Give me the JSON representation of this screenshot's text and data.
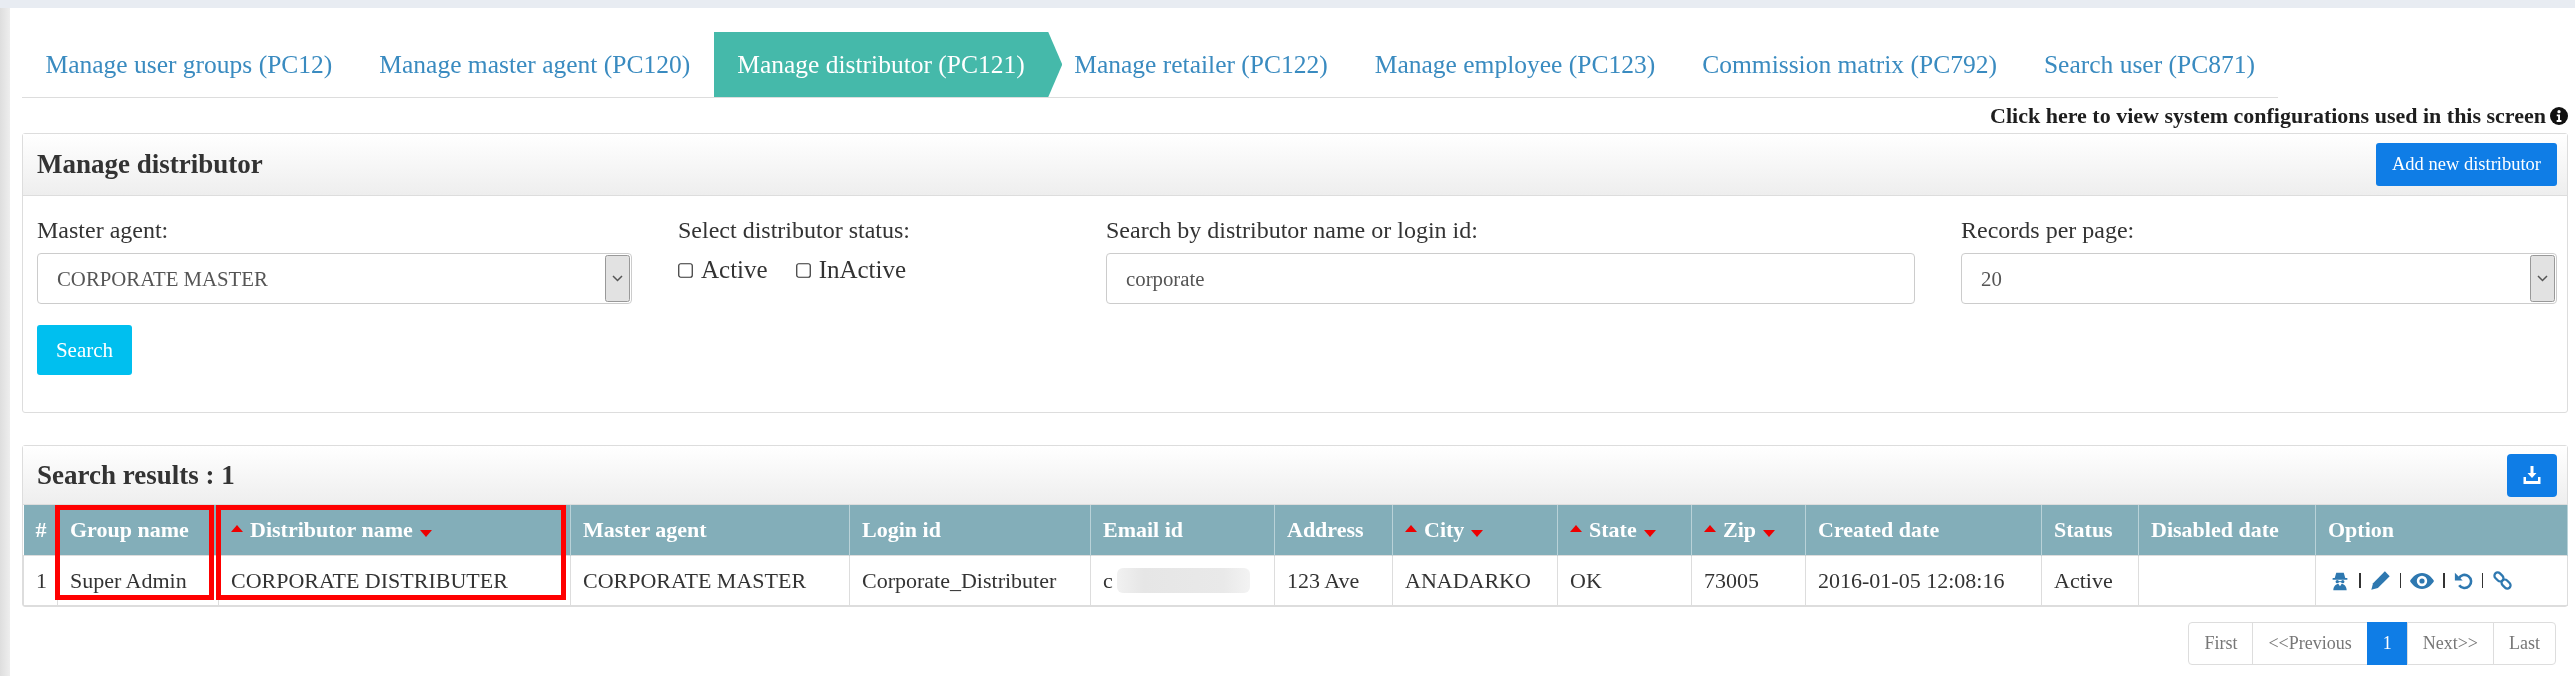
{
  "tabs": [
    {
      "label": "Manage user groups (PC12)",
      "selected": false
    },
    {
      "label": "Manage master agent (PC120)",
      "selected": false
    },
    {
      "label": "Manage distributor (PC121)",
      "selected": true
    },
    {
      "label": "Manage retailer (PC122)",
      "selected": false
    },
    {
      "label": "Manage employee (PC123)",
      "selected": false
    },
    {
      "label": "Commission matrix (PC792)",
      "selected": false
    },
    {
      "label": "Search user (PC871)",
      "selected": false
    }
  ],
  "config_link": "Click here to view system configurations used in this screen",
  "filter_panel": {
    "title": "Manage distributor",
    "add_button": "Add new distributor",
    "master_agent": {
      "label": "Master agent:",
      "value": "CORPORATE MASTER"
    },
    "status": {
      "label": "Select distributor status:",
      "options": [
        {
          "label": "Active",
          "checked": false
        },
        {
          "label": "InActive",
          "checked": false
        }
      ]
    },
    "search": {
      "label": "Search by distributor name or login id:",
      "value": "corporate"
    },
    "records_per_page": {
      "label": "Records per page:",
      "value": "20"
    },
    "search_button": "Search"
  },
  "results_panel": {
    "title": "Search results : 1",
    "table": {
      "columns": [
        {
          "label": "#",
          "sortable": false,
          "highlighted": false
        },
        {
          "label": "Group name",
          "sortable": false,
          "highlighted": true
        },
        {
          "label": "Distributor name",
          "sortable": true,
          "highlighted": true
        },
        {
          "label": "Master agent",
          "sortable": false,
          "highlighted": false
        },
        {
          "label": "Login id",
          "sortable": false,
          "highlighted": false
        },
        {
          "label": "Email id",
          "sortable": false,
          "highlighted": false
        },
        {
          "label": "Address",
          "sortable": false,
          "highlighted": false
        },
        {
          "label": "City",
          "sortable": true,
          "highlighted": false
        },
        {
          "label": "State",
          "sortable": true,
          "highlighted": false
        },
        {
          "label": "Zip",
          "sortable": true,
          "highlighted": false
        },
        {
          "label": "Created date",
          "sortable": false,
          "highlighted": false
        },
        {
          "label": "Status",
          "sortable": false,
          "highlighted": false
        },
        {
          "label": "Disabled date",
          "sortable": false,
          "highlighted": false
        },
        {
          "label": "Option",
          "sortable": false,
          "highlighted": false
        }
      ],
      "rows": [
        {
          "cells": [
            {
              "kind": "text",
              "text": "1"
            },
            {
              "kind": "text",
              "text": "Super Admin"
            },
            {
              "kind": "text",
              "text": "CORPORATE DISTRIBUTER"
            },
            {
              "kind": "text",
              "text": "CORPORATE MASTER"
            },
            {
              "kind": "text",
              "text": "Corporate_Distributer"
            },
            {
              "kind": "redacted",
              "text": "c"
            },
            {
              "kind": "text",
              "text": "123 Ave"
            },
            {
              "kind": "text",
              "text": "ANADARKO"
            },
            {
              "kind": "text",
              "text": "OK"
            },
            {
              "kind": "text",
              "text": "73005"
            },
            {
              "kind": "text",
              "text": "2016-01-05 12:08:16"
            },
            {
              "kind": "text",
              "text": "Active"
            },
            {
              "kind": "empty"
            },
            {
              "kind": "actions"
            }
          ]
        }
      ]
    }
  },
  "pagination": [
    {
      "label": "First",
      "selected": false
    },
    {
      "label": "<<Previous",
      "selected": false
    },
    {
      "label": "1",
      "selected": true
    },
    {
      "label": "Next>>",
      "selected": false
    },
    {
      "label": "Last",
      "selected": false
    }
  ]
}
